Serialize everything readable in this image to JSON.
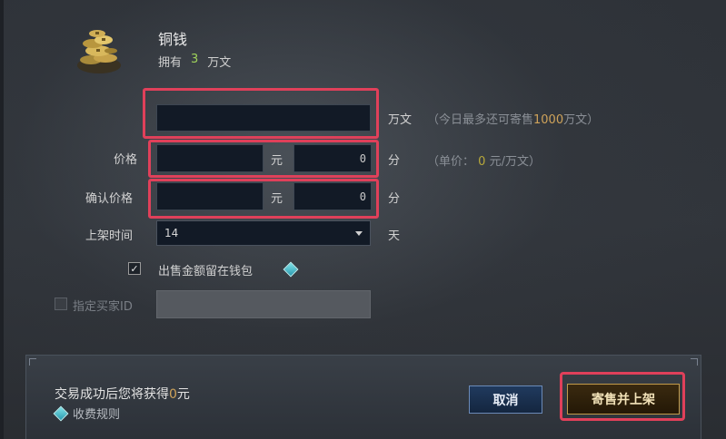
{
  "item": {
    "icon": "coin-pile-icon",
    "name": "铜钱",
    "own_label": "拥有",
    "own_count": "3",
    "own_unit": "万文"
  },
  "amount": {
    "value": "",
    "unit": "万文",
    "hint_prefix": "（今日最多还可寄售",
    "hint_value": "1000",
    "hint_suffix": "万文）"
  },
  "price": {
    "label": "价格",
    "yuan_value": "",
    "yuan_unit": "元",
    "fen_value": "0",
    "fen_unit": "分",
    "unit_price_prefix": "（单价：",
    "unit_price_value": "0",
    "unit_price_suffix": "元/万文）"
  },
  "confirm_price": {
    "label": "确认价格",
    "yuan_value": "",
    "yuan_unit": "元",
    "fen_value": "0",
    "fen_unit": "分"
  },
  "listing_time": {
    "label": "上架时间",
    "value": "14",
    "unit": "天"
  },
  "keep_in_wallet": {
    "checked": true,
    "label": "出售金额留在钱包"
  },
  "designated_buyer": {
    "checked": false,
    "label": "指定买家ID",
    "value": ""
  },
  "footer": {
    "earn_prefix": "交易成功后您将获得",
    "earn_value": "0",
    "earn_unit": "元",
    "fee_rules": "收费规则"
  },
  "buttons": {
    "cancel": "取消",
    "list": "寄售并上架"
  },
  "colors": {
    "highlight_frame": "#e0405a",
    "positive_number": "#9fd25a",
    "accent_number": "#cfa35a"
  }
}
